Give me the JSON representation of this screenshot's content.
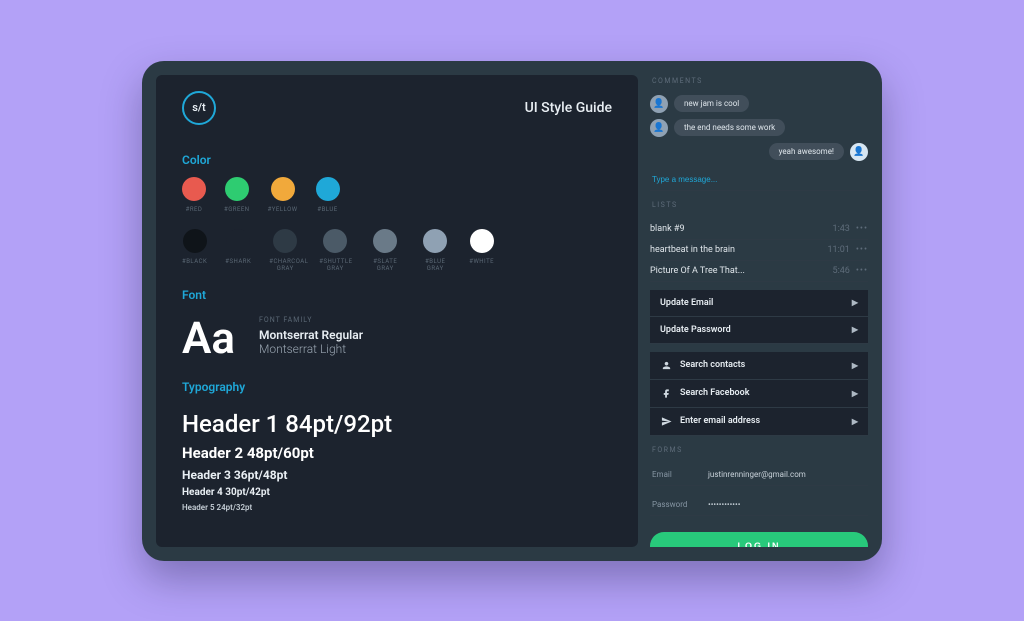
{
  "header": {
    "logo_text": "s/t",
    "title": "UI Style Guide"
  },
  "sections": {
    "color_label": "Color",
    "font_label": "Font",
    "typography_label": "Typography"
  },
  "palette_primary": [
    {
      "name": "#RED",
      "hex": "#e85a4f"
    },
    {
      "name": "#GREEN",
      "hex": "#2ecc71"
    },
    {
      "name": "#YELLOW",
      "hex": "#f1a93b"
    },
    {
      "name": "#BLUE",
      "hex": "#1fa8d8"
    }
  ],
  "palette_grays": [
    {
      "name": "#BLACK",
      "hex": "#0f1419"
    },
    {
      "name": "#SHARK",
      "hex": "#1c232e"
    },
    {
      "name": "#CHARCOAL GRAY",
      "hex": "#2e3a45"
    },
    {
      "name": "#SHUTTLE GRAY",
      "hex": "#4b5a67"
    },
    {
      "name": "#SLATE GRAY",
      "hex": "#6a7a88"
    },
    {
      "name": "#BLUE GRAY",
      "hex": "#8fa1b3"
    },
    {
      "name": "#WHITE",
      "hex": "#ffffff"
    }
  ],
  "font": {
    "glyph": "Aa",
    "mini_label": "FONT FAMILY",
    "family_regular": "Montserrat Regular",
    "family_light": "Montserrat Light"
  },
  "typography": {
    "h1": "Header 1 84pt/92pt",
    "h2": "Header 2 48pt/60pt",
    "h3": "Header 3 36pt/48pt",
    "h4": "Header 4 30pt/42pt",
    "h5": "Header 5 24pt/32pt"
  },
  "sidebar": {
    "comments_label": "COMMENTS",
    "comments": [
      {
        "side": "left",
        "text": "new jam is cool"
      },
      {
        "side": "left",
        "text": "the end needs some work"
      },
      {
        "side": "right",
        "text": "yeah awesome!"
      }
    ],
    "message_placeholder": "Type a message...",
    "lists_label": "LISTS",
    "lists": [
      {
        "name": "blank #9",
        "time": "1:43"
      },
      {
        "name": "heartbeat in the brain",
        "time": "11:01"
      },
      {
        "name": "Picture Of A Tree That...",
        "time": "5:46"
      }
    ],
    "settings": [
      {
        "label": "Update Email"
      },
      {
        "label": "Update Password"
      }
    ],
    "search": [
      {
        "icon": "contacts",
        "label": "Search contacts"
      },
      {
        "icon": "facebook",
        "label": "Search Facebook"
      },
      {
        "icon": "send",
        "label": "Enter email address"
      }
    ],
    "forms_label": "FORMS",
    "form": {
      "email_label": "Email",
      "email_value": "justinrenninger@gmail.com",
      "password_label": "Password",
      "password_value": "••••••••••••"
    },
    "login_label": "LOG IN"
  }
}
